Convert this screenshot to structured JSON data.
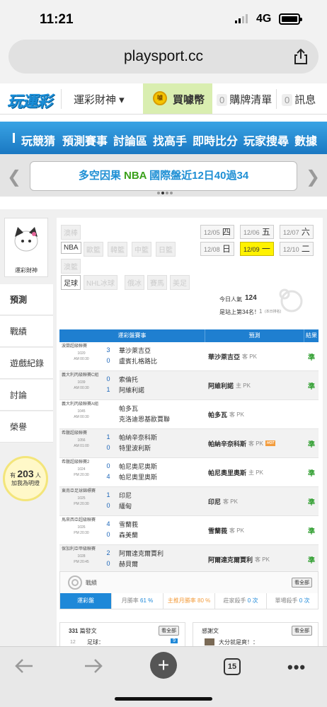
{
  "status": {
    "time": "11:21",
    "network": "4G"
  },
  "browser": {
    "url": "playsport.cc",
    "tab_count": "15",
    "back_icon": "arrow-left-icon",
    "forward_icon": "arrow-right-icon"
  },
  "nav": {
    "logo": "玩運彩",
    "user_menu": "運彩財神 ▾",
    "buy": "買噱幣",
    "purchase_list_count": "0",
    "purchase_list": "購牌清單",
    "message_count": "0",
    "message": "訊息"
  },
  "menu": [
    "玩競猜",
    "預測賽事",
    "討論區",
    "找高手",
    "即時比分",
    "玩家搜尋",
    "數據"
  ],
  "banner": {
    "prefix": "多空因果 ",
    "highlight": "NBA",
    "suffix": " 國際盤近12日40過34"
  },
  "profile": {
    "name": "運彩財神",
    "tabs": [
      "預測",
      "戰績",
      "遊戲紀錄",
      "討論",
      "榮譽"
    ],
    "fans_prefix": "有",
    "fans_count": "203",
    "fans_unit": "人",
    "fans_suffix": "加我為明燈"
  },
  "filters": {
    "row1": [
      "澳棒"
    ],
    "row2": [
      "NBA",
      "歐籃",
      "韓籃",
      "中籃",
      "日籃"
    ],
    "row3": [
      "澳籃"
    ],
    "row4": [
      "足球",
      "NHL冰球",
      "俄冰",
      "賽馬",
      "美足"
    ]
  },
  "dates": [
    {
      "md": "12/05",
      "dow": "四"
    },
    {
      "md": "12/06",
      "dow": "五"
    },
    {
      "md": "12/07",
      "dow": "六"
    },
    {
      "md": "12/08",
      "dow": "日"
    },
    {
      "md": "12/09",
      "dow": "一"
    },
    {
      "md": "12/10",
      "dow": "二"
    }
  ],
  "popularity": {
    "label": "今日人氣",
    "value": "124",
    "rank": "是站上第34名！",
    "rank_sub": "1",
    "rank_small": "(本日排名)"
  },
  "table": {
    "headers": [
      "運彩盤賽事",
      "預測",
      "結果"
    ],
    "rows": [
      {
        "league": "波蘭超級聯賽",
        "gid": "1020",
        "time": "AM 00:30",
        "s1": "3",
        "t1": "華沙萊吉亞",
        "s2": "0",
        "t2": "盧賓扎格路比",
        "pred": "華沙萊吉亞",
        "side": "客 PK",
        "hot": "",
        "res": "準"
      },
      {
        "league": "義大利丙級聯賽C組",
        "gid": "1039",
        "time": "AM 00:30",
        "s1": "0",
        "t1": "索倫托",
        "s2": "1",
        "t2": "阿維利諾",
        "pred": "阿維利諾",
        "side": "主 PK",
        "hot": "",
        "res": "準"
      },
      {
        "league": "義大利丙級聯賽A組",
        "gid": "1045",
        "time": "AM 00:30",
        "s1": "",
        "t1": "帕多瓦",
        "s2": "",
        "t2": "克洛迪恩基歐賈聯",
        "pred": "帕多瓦",
        "side": "客 PK",
        "hot": "",
        "res": ""
      },
      {
        "league": "希臘超級聯賽",
        "gid": "1056",
        "time": "AM 01:00",
        "s1": "1",
        "t1": "帕納辛奈科斯",
        "s2": "0",
        "t2": "特里波利斯",
        "pred": "帕納辛奈科斯",
        "side": "客 PK",
        "hot": "HOT",
        "res": "準"
      },
      {
        "league": "希臘超級聯賽2",
        "gid": "1024",
        "time": "PM 20:30",
        "s1": "0",
        "t1": "帕尼奧尼奧斯",
        "s2": "4",
        "t2": "帕尼奧里奧斯",
        "pred": "帕尼奧里奧斯",
        "side": "主 PK",
        "hot": "",
        "res": "準"
      },
      {
        "league": "東南亞足球錦標賽",
        "gid": "1025",
        "time": "PM 20:30",
        "s1": "1",
        "t1": "印尼",
        "s2": "0",
        "t2": "緬甸",
        "pred": "印尼",
        "side": "客 PK",
        "hot": "",
        "res": "準"
      },
      {
        "league": "馬來西亞超級聯賽",
        "gid": "1026",
        "time": "PM 20:30",
        "s1": "4",
        "t1": "雪蘭莪",
        "s2": "0",
        "t2": "森美蘭",
        "pred": "雪蘭莪",
        "side": "客 PK",
        "hot": "",
        "res": "準"
      },
      {
        "league": "保加利亞甲級聯賽",
        "gid": "1028",
        "time": "PM 20:45",
        "s1": "2",
        "t1": "阿爾達克爾賈利",
        "s2": "0",
        "t2": "赫貝爾",
        "pred": "阿爾達克爾賈利",
        "side": "客 PK",
        "hot": "",
        "res": "準"
      }
    ]
  },
  "record": {
    "title": "戰績",
    "all": "看全部",
    "lead": "運彩盤",
    "items": [
      {
        "label": "月勝率",
        "value": "61 %"
      },
      {
        "label": "主推月勝率",
        "value": "80 %"
      },
      {
        "label": "莊家殺手",
        "value": "0 次"
      },
      {
        "label": "單場殺手",
        "value": "0 次"
      }
    ]
  },
  "posts": {
    "count": "331",
    "label": "篇發文",
    "all": "看全部",
    "first_num": "12",
    "first_title": "足球：",
    "first_badge": "9"
  },
  "thanks": {
    "label": "感謝文",
    "all": "看全部",
    "first_title": "大分就是爽！："
  }
}
